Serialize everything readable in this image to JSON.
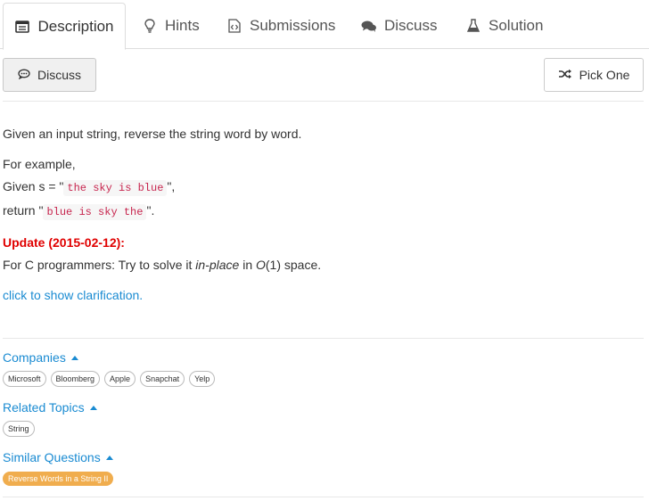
{
  "tabs": [
    {
      "label": "Description",
      "icon": "list-icon"
    },
    {
      "label": "Hints",
      "icon": "lightbulb-icon"
    },
    {
      "label": "Submissions",
      "icon": "code-file-icon"
    },
    {
      "label": "Discuss",
      "icon": "comments-icon"
    },
    {
      "label": "Solution",
      "icon": "flask-icon"
    }
  ],
  "toolbar": {
    "discuss_label": "Discuss",
    "pick_one_label": "Pick One"
  },
  "description": {
    "intro": "Given an input string, reverse the string word by word.",
    "example_label": "For example,",
    "given_prefix": "Given s = \"",
    "given_code": "the sky is blue",
    "given_suffix": "\",",
    "return_prefix": "return \"",
    "return_code": "blue is sky the",
    "return_suffix": "\".",
    "update_heading": "Update (2015-02-12):",
    "update_prefix": "For C programmers: Try to solve it ",
    "update_em": "in-place",
    "update_mid": " in ",
    "update_o": "O",
    "update_suffix": "(1) space.",
    "clarification_link": "click to show clarification."
  },
  "companies": {
    "title": "Companies",
    "tags": [
      "Microsoft",
      "Bloomberg",
      "Apple",
      "Snapchat",
      "Yelp"
    ]
  },
  "related_topics": {
    "title": "Related Topics",
    "tags": [
      "String"
    ]
  },
  "similar_questions": {
    "title": "Similar Questions",
    "tags": [
      "Reverse Words in a String II"
    ]
  },
  "colors": {
    "link": "#1a8bd2",
    "update": "#e00000",
    "code": "#c7254e",
    "similar_tag": "#f0ad4e"
  }
}
